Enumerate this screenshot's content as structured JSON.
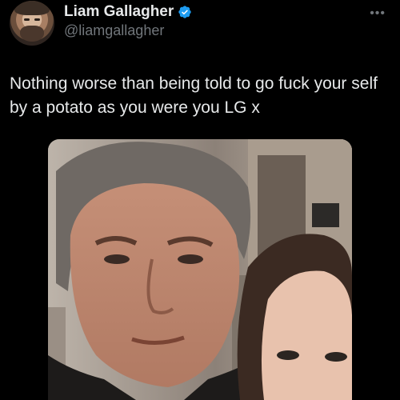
{
  "author": {
    "display_name": "Liam Gallagher",
    "handle": "@liamgallagher",
    "verified": true,
    "verified_color": "#1d9bf0"
  },
  "post": {
    "text": "Nothing worse than being told to go fuck your self by a potato as you were you LG x"
  },
  "actions": {
    "more_icon": "more-horizontal-icon"
  },
  "colors": {
    "background": "#000000",
    "text_primary": "#e7e9ea",
    "text_secondary": "#71767b"
  }
}
